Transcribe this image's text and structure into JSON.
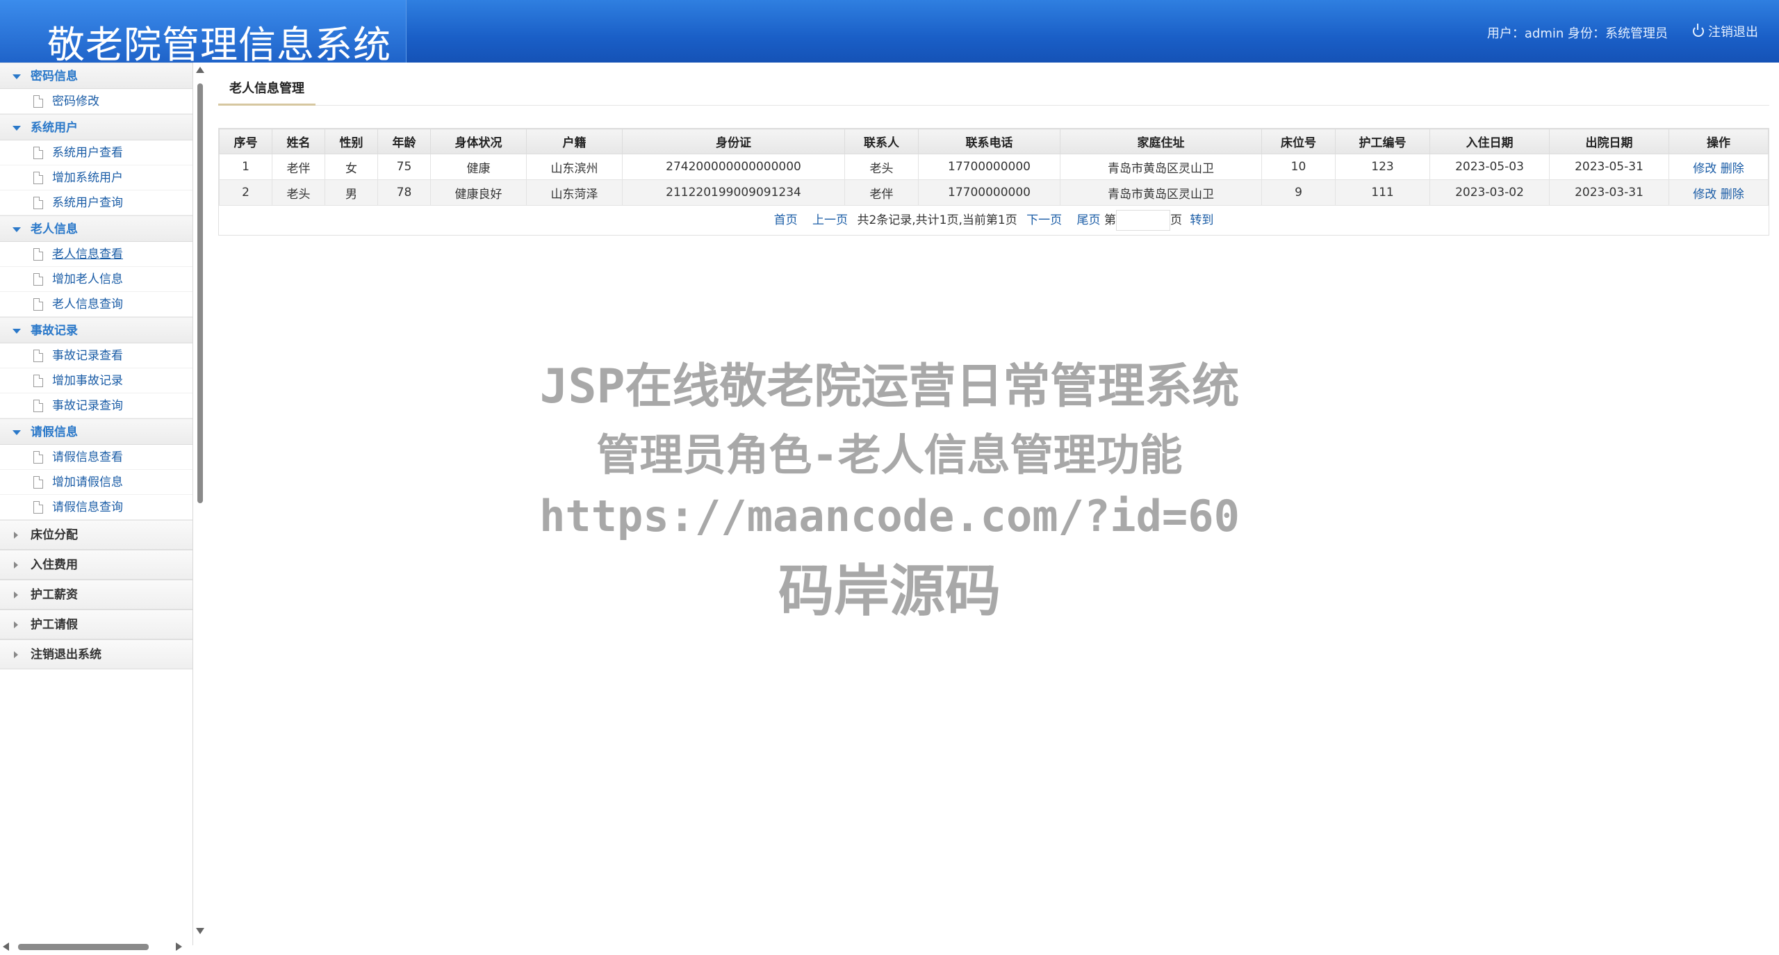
{
  "header": {
    "title": "敬老院管理信息系统",
    "user_info": "用户：admin 身份：系统管理员",
    "logout_label": "注销退出"
  },
  "sidebar": {
    "groups": [
      {
        "label": "密码信息",
        "items": [
          "密码修改"
        ]
      },
      {
        "label": "系统用户",
        "items": [
          "系统用户查看",
          "增加系统用户",
          "系统用户查询"
        ]
      },
      {
        "label": "老人信息",
        "items": [
          "老人信息查看",
          "增加老人信息",
          "老人信息查询"
        ]
      },
      {
        "label": "事故记录",
        "items": [
          "事故记录查看",
          "增加事故记录",
          "事故记录查询"
        ]
      },
      {
        "label": "请假信息",
        "items": [
          "请假信息查看",
          "增加请假信息",
          "请假信息查询"
        ]
      }
    ],
    "closed_groups": [
      "床位分配",
      "入住费用",
      "护工薪资",
      "护工请假",
      "注销退出系统"
    ]
  },
  "main": {
    "tab": "老人信息管理",
    "table": {
      "headers": [
        "序号",
        "姓名",
        "性别",
        "年龄",
        "身体状况",
        "户籍",
        "身份证",
        "联系人",
        "联系电话",
        "家庭住址",
        "床位号",
        "护工编号",
        "入住日期",
        "出院日期",
        "操作"
      ],
      "rows": [
        [
          "1",
          "老伴",
          "女",
          "75",
          "健康",
          "山东滨州",
          "274200000000000000",
          "老头",
          "17700000000",
          "青岛市黄岛区灵山卫",
          "10",
          "123",
          "2023-05-03",
          "2023-05-31"
        ],
        [
          "2",
          "老头",
          "男",
          "78",
          "健康良好",
          "山东菏泽",
          "211220199009091234",
          "老伴",
          "17700000000",
          "青岛市黄岛区灵山卫",
          "9",
          "111",
          "2023-03-02",
          "2023-03-31"
        ]
      ],
      "action_edit": "修改",
      "action_delete": "删除"
    },
    "pager": {
      "first": "首页",
      "prev": "上一页",
      "summary": "共2条记录,共计1页,当前第1页",
      "next": "下一页",
      "last": "尾页",
      "page_prefix": "第",
      "page_suffix": "页",
      "goto": "转到",
      "page_value": ""
    }
  },
  "watermark": {
    "line1": "JSP在线敬老院运营日常管理系统",
    "line2": "管理员角色-老人信息管理功能",
    "line3": "https://maancode.com/?id=60",
    "line4": "码岸源码"
  }
}
